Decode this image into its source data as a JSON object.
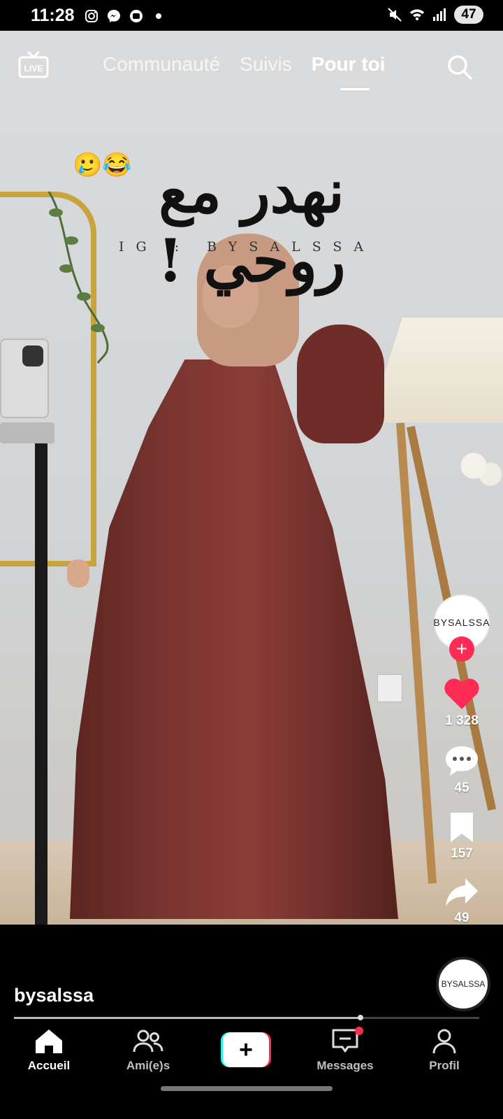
{
  "status_bar": {
    "time": "11:28",
    "left_icons": [
      "instagram-icon",
      "messenger-icon",
      "screen-icon",
      "dot-icon"
    ],
    "right_icons": [
      "mute-icon",
      "wifi-icon",
      "signal-icon"
    ],
    "battery": "47"
  },
  "top_nav": {
    "live_label": "LIVE",
    "tabs": [
      {
        "label": "Communauté",
        "active": false
      },
      {
        "label": "Suivis",
        "active": false
      },
      {
        "label": "Pour toi",
        "active": true
      }
    ]
  },
  "video": {
    "caption_emojis": "🥲😂",
    "caption_arabic": "نهدر مع روحي !",
    "caption_watermark": "IG : BYSALSSA"
  },
  "actions": {
    "avatar_text": "BYSALSSA",
    "likes": "1 328",
    "comments": "45",
    "saves": "157",
    "shares": "49",
    "disc_text": "BYSALSSA"
  },
  "author": {
    "username": "bysalssa"
  },
  "progress": {
    "fraction": 0.745
  },
  "bottom_nav": {
    "home": "Accueil",
    "friends": "Ami(e)s",
    "create": "+",
    "messages": "Messages",
    "profile": "Profil"
  },
  "colors": {
    "accent": "#fe2c55",
    "teal": "#25f4ee",
    "heart": "#fe2c55"
  }
}
